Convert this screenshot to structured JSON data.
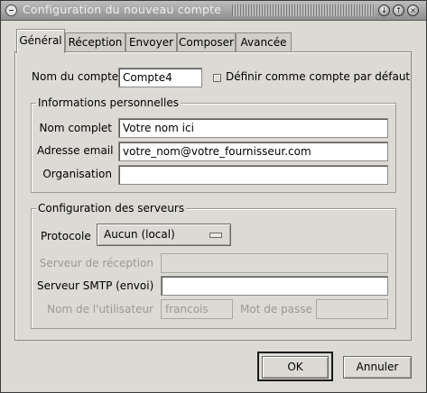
{
  "window": {
    "title": "Configuration du nouveau compte"
  },
  "tabs": [
    {
      "label": "Général",
      "active": true
    },
    {
      "label": "Réception",
      "active": false
    },
    {
      "label": "Envoyer",
      "active": false
    },
    {
      "label": "Composer",
      "active": false
    },
    {
      "label": "Avancée",
      "active": false
    }
  ],
  "account": {
    "name_label": "Nom du compte",
    "name_value": "Compte4",
    "default_checkbox_label": "Définir comme compte par défaut",
    "default_checked": false
  },
  "personal": {
    "frame_title": "Informations personnelles",
    "fullname_label": "Nom complet",
    "fullname_value": "Votre nom ici",
    "email_label": "Adresse email",
    "email_value": "votre_nom@votre_fournisseur.com",
    "org_label": "Organisation",
    "org_value": ""
  },
  "servers": {
    "frame_title": "Configuration des serveurs",
    "protocol_label": "Protocole",
    "protocol_value": "Aucun (local)",
    "recv_label": "Serveur de réception",
    "recv_value": "",
    "smtp_label": "Serveur SMTP (envoi)",
    "smtp_value": "",
    "user_label": "Nom de l'utilisateur",
    "user_value": "francois",
    "pass_label": "Mot de passe",
    "pass_value": ""
  },
  "buttons": {
    "ok": "OK",
    "cancel": "Annuler"
  },
  "colors": {
    "background": "#dcdad5",
    "disabled_text": "#9a9893"
  }
}
